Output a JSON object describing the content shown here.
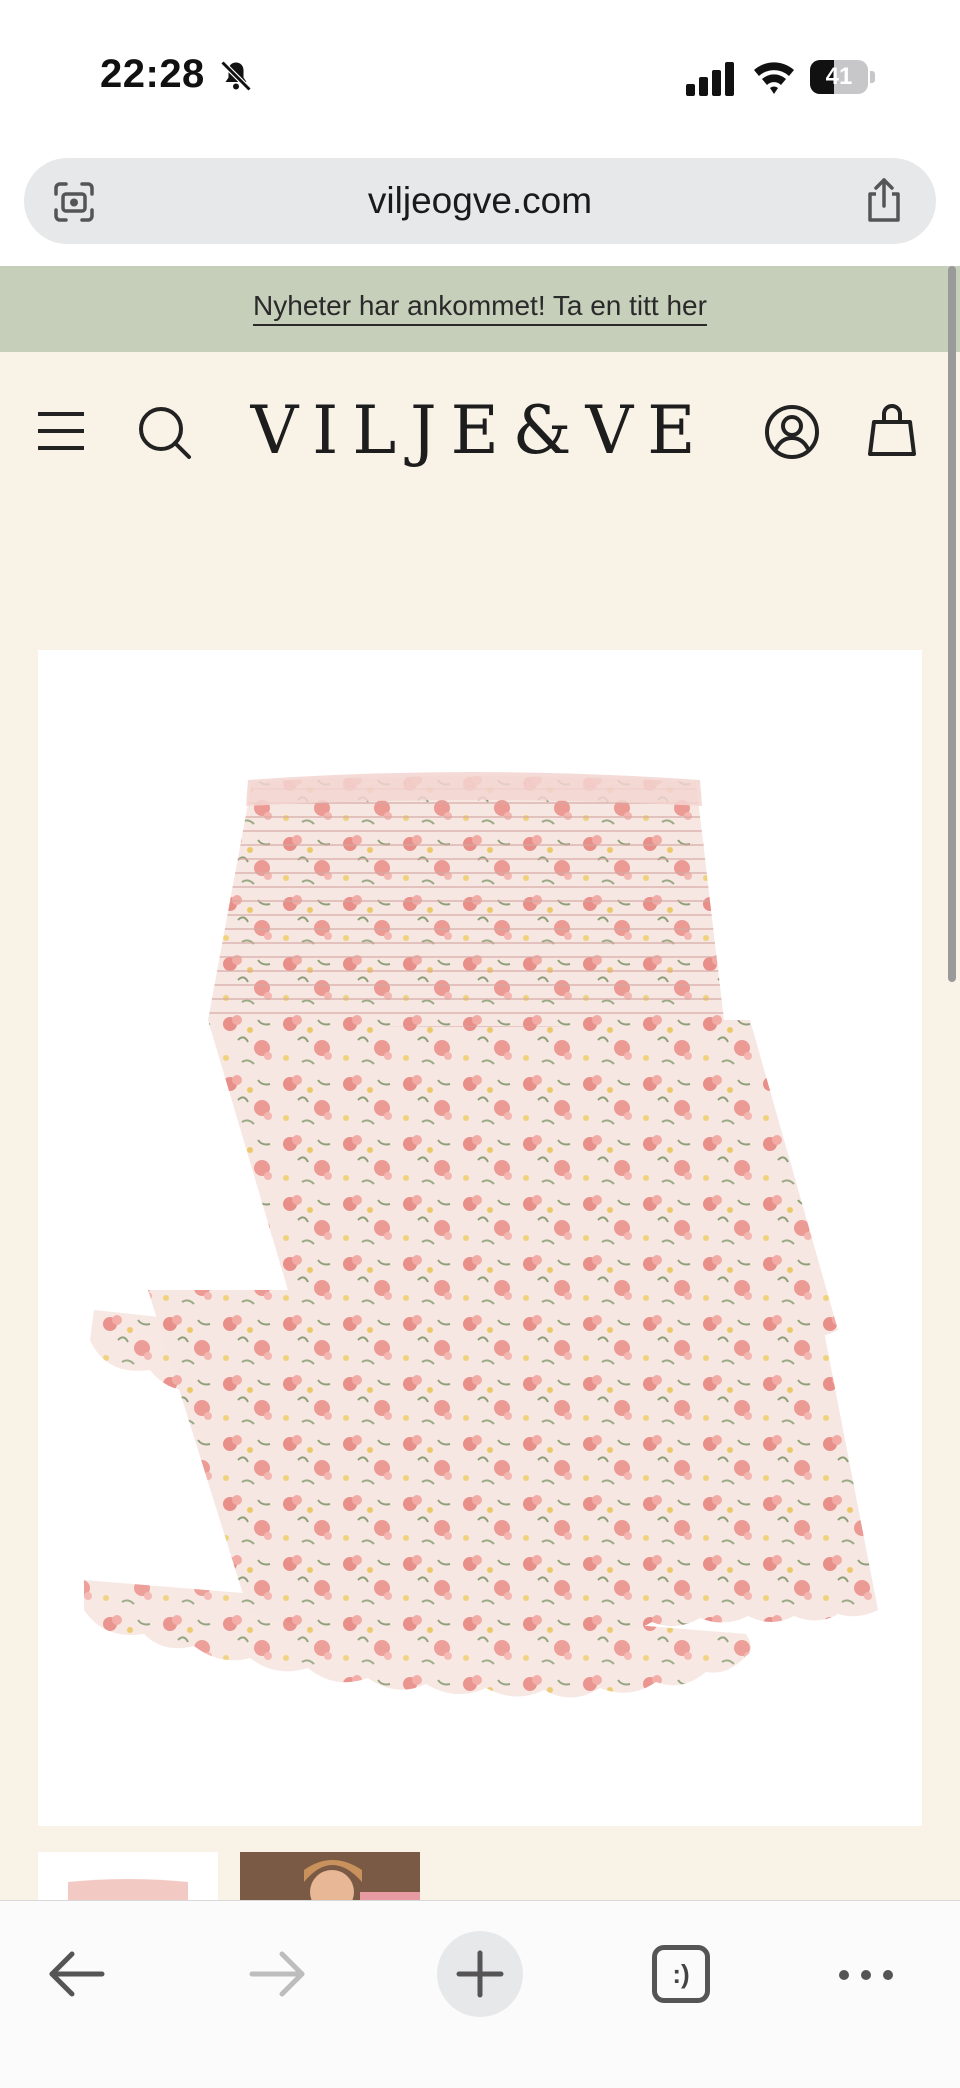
{
  "status_bar": {
    "time": "22:28",
    "battery": "41",
    "battery_level": 0.41
  },
  "browser": {
    "url": "viljeogve.com",
    "tabs_label": ":)"
  },
  "site": {
    "announcement": "Nyheter har ankommet! Ta en titt her",
    "logo": "VILJE&VE"
  },
  "icons": {
    "bell": "bell-slash-icon",
    "signal": "cellular-signal-icon",
    "wifi": "wifi-icon",
    "scan": "page-scan-icon",
    "share": "share-icon",
    "menu": "hamburger-menu-icon",
    "search": "search-icon",
    "account": "account-icon",
    "cart": "shopping-bag-icon",
    "back": "back-arrow-icon",
    "forward": "forward-arrow-icon",
    "new_tab": "plus-icon",
    "more": "more-dots-icon"
  },
  "colors": {
    "page_bg": "#f8f2e7",
    "announcement_bg": "#c5cfba",
    "product_bg": "#ffffff"
  }
}
